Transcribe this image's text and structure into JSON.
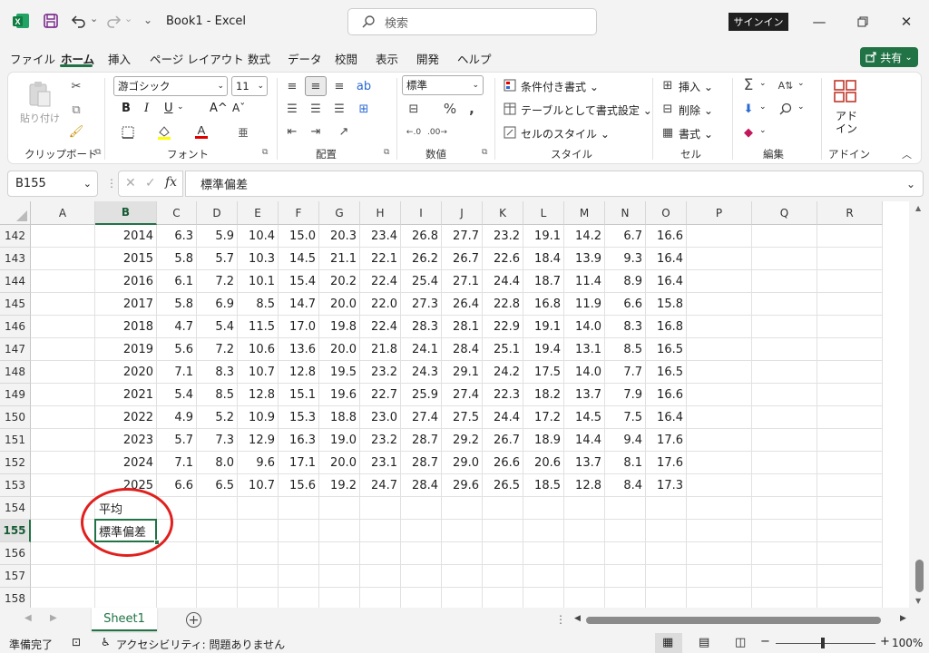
{
  "titlebar": {
    "filename": "Book1",
    "separator": "-",
    "app": "Excel",
    "search_placeholder": "検索",
    "signin": "サインイン",
    "undo_dropdown": "⌄",
    "redo_dropdown": "⌄"
  },
  "menu": {
    "items": [
      "ファイル",
      "ホーム",
      "挿入",
      "ページ レイアウト",
      "数式",
      "データ",
      "校閲",
      "表示",
      "開発",
      "ヘルプ"
    ],
    "active_index": 1,
    "share": "共有"
  },
  "ribbon": {
    "clipboard": {
      "paste": "貼り付け",
      "group": "クリップボード"
    },
    "font": {
      "name": "游ゴシック",
      "size": "11",
      "group": "フォント",
      "bold": "B",
      "italic": "I",
      "underline": "U",
      "grow": "A^",
      "shrink": "Aˇ"
    },
    "alignment": {
      "group": "配置"
    },
    "number": {
      "format": "標準",
      "group": "数値"
    },
    "styles": {
      "conditional": "条件付き書式",
      "table": "テーブルとして書式設定",
      "cell_styles": "セルのスタイル",
      "group": "スタイル"
    },
    "cells": {
      "insert": "挿入",
      "delete": "削除",
      "format": "書式",
      "group": "セル"
    },
    "editing": {
      "group": "編集"
    },
    "addins": {
      "label": "アドイン",
      "group": "アドイン"
    }
  },
  "formula_bar": {
    "name_box": "B155",
    "fx": "fx",
    "content": "標準偏差"
  },
  "grid": {
    "columns": [
      "A",
      "B",
      "C",
      "D",
      "E",
      "F",
      "G",
      "H",
      "I",
      "J",
      "K",
      "L",
      "M",
      "N",
      "O",
      "P",
      "Q",
      "R"
    ],
    "selected_column": "B",
    "selected_row": "155",
    "rows": [
      {
        "num": "142",
        "cells": [
          "",
          "2014",
          "6.3",
          "5.9",
          "10.4",
          "15.0",
          "20.3",
          "23.4",
          "26.8",
          "27.7",
          "23.2",
          "19.1",
          "14.2",
          "6.7",
          "16.6"
        ]
      },
      {
        "num": "143",
        "cells": [
          "",
          "2015",
          "5.8",
          "5.7",
          "10.3",
          "14.5",
          "21.1",
          "22.1",
          "26.2",
          "26.7",
          "22.6",
          "18.4",
          "13.9",
          "9.3",
          "16.4"
        ]
      },
      {
        "num": "144",
        "cells": [
          "",
          "2016",
          "6.1",
          "7.2",
          "10.1",
          "15.4",
          "20.2",
          "22.4",
          "25.4",
          "27.1",
          "24.4",
          "18.7",
          "11.4",
          "8.9",
          "16.4"
        ]
      },
      {
        "num": "145",
        "cells": [
          "",
          "2017",
          "5.8",
          "6.9",
          "8.5",
          "14.7",
          "20.0",
          "22.0",
          "27.3",
          "26.4",
          "22.8",
          "16.8",
          "11.9",
          "6.6",
          "15.8"
        ]
      },
      {
        "num": "146",
        "cells": [
          "",
          "2018",
          "4.7",
          "5.4",
          "11.5",
          "17.0",
          "19.8",
          "22.4",
          "28.3",
          "28.1",
          "22.9",
          "19.1",
          "14.0",
          "8.3",
          "16.8"
        ]
      },
      {
        "num": "147",
        "cells": [
          "",
          "2019",
          "5.6",
          "7.2",
          "10.6",
          "13.6",
          "20.0",
          "21.8",
          "24.1",
          "28.4",
          "25.1",
          "19.4",
          "13.1",
          "8.5",
          "16.5"
        ]
      },
      {
        "num": "148",
        "cells": [
          "",
          "2020",
          "7.1",
          "8.3",
          "10.7",
          "12.8",
          "19.5",
          "23.2",
          "24.3",
          "29.1",
          "24.2",
          "17.5",
          "14.0",
          "7.7",
          "16.5"
        ]
      },
      {
        "num": "149",
        "cells": [
          "",
          "2021",
          "5.4",
          "8.5",
          "12.8",
          "15.1",
          "19.6",
          "22.7",
          "25.9",
          "27.4",
          "22.3",
          "18.2",
          "13.7",
          "7.9",
          "16.6"
        ]
      },
      {
        "num": "150",
        "cells": [
          "",
          "2022",
          "4.9",
          "5.2",
          "10.9",
          "15.3",
          "18.8",
          "23.0",
          "27.4",
          "27.5",
          "24.4",
          "17.2",
          "14.5",
          "7.5",
          "16.4"
        ]
      },
      {
        "num": "151",
        "cells": [
          "",
          "2023",
          "5.7",
          "7.3",
          "12.9",
          "16.3",
          "19.0",
          "23.2",
          "28.7",
          "29.2",
          "26.7",
          "18.9",
          "14.4",
          "9.4",
          "17.6"
        ]
      },
      {
        "num": "152",
        "cells": [
          "",
          "2024",
          "7.1",
          "8.0",
          "9.6",
          "17.1",
          "20.0",
          "23.1",
          "28.7",
          "29.0",
          "26.6",
          "20.6",
          "13.7",
          "8.1",
          "17.6"
        ]
      },
      {
        "num": "153",
        "cells": [
          "",
          "2025",
          "6.6",
          "6.5",
          "10.7",
          "15.6",
          "19.2",
          "24.7",
          "28.4",
          "29.6",
          "26.5",
          "18.5",
          "12.8",
          "8.4",
          "17.3"
        ]
      },
      {
        "num": "154",
        "cells": [
          "",
          "平均"
        ]
      },
      {
        "num": "155",
        "cells": [
          "",
          "標準偏差"
        ]
      },
      {
        "num": "156",
        "cells": []
      },
      {
        "num": "157",
        "cells": []
      },
      {
        "num": "158",
        "cells": []
      }
    ]
  },
  "sheets": {
    "tabs": [
      "Sheet1"
    ],
    "add": "+"
  },
  "status": {
    "ready": "準備完了",
    "accessibility": "アクセシビリティ: 問題ありません",
    "zoom": "100%"
  },
  "colors": {
    "accent": "#217346",
    "highlight_ring": "#e0201e"
  }
}
